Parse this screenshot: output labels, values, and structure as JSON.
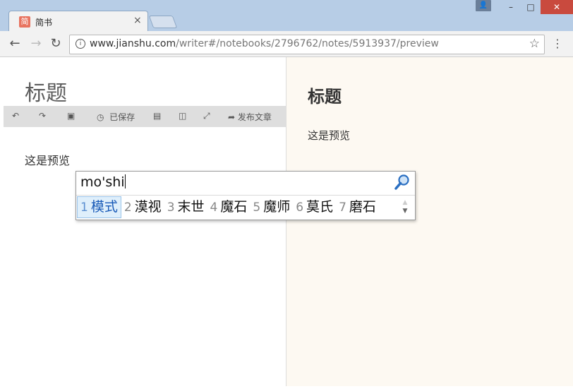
{
  "window": {
    "user_glyph": "👤",
    "minimize_glyph": "–",
    "maximize_glyph": "□",
    "close_glyph": "✕"
  },
  "tab": {
    "favicon_text": "简",
    "title": "简书",
    "close_glyph": "×"
  },
  "toolbar": {
    "back_glyph": "←",
    "forward_glyph": "→",
    "reload_glyph": "↻",
    "info_glyph": "i",
    "url_host": "www.jianshu.com",
    "url_path": "/writer#/notebooks/2796762/notes/5913937/preview",
    "star_glyph": "☆",
    "menu_glyph": "⋮"
  },
  "editor": {
    "title": "标题",
    "toolbar": {
      "undo_glyph": "↶",
      "redo_glyph": "↷",
      "image_glyph": "▣",
      "saved_glyph": "◷",
      "saved_label": "已保存",
      "save_glyph": "▤",
      "split_glyph": "◫",
      "fullscreen_glyph": "⤢",
      "publish_glyph": "➦",
      "publish_label": "发布文章"
    },
    "body": "这是预览"
  },
  "preview": {
    "title": "标题",
    "body": "这是预览"
  },
  "ime": {
    "input": "mo'shi",
    "candidates": [
      {
        "num": "1",
        "text": "模式"
      },
      {
        "num": "2",
        "text": "漠视"
      },
      {
        "num": "3",
        "text": "末世"
      },
      {
        "num": "4",
        "text": "魔石"
      },
      {
        "num": "5",
        "text": "魔师"
      },
      {
        "num": "6",
        "text": "莫氏"
      },
      {
        "num": "7",
        "text": "磨石"
      }
    ],
    "selected_index": 0,
    "scroll_up_glyph": "▲",
    "scroll_down_glyph": "▼"
  },
  "colors": {
    "frame": "#b7cde6",
    "favicon": "#e8735f",
    "close_button": "#c94a3e",
    "preview_bg": "#fdf9f2",
    "candidate_selected": "#1a5bb8"
  }
}
